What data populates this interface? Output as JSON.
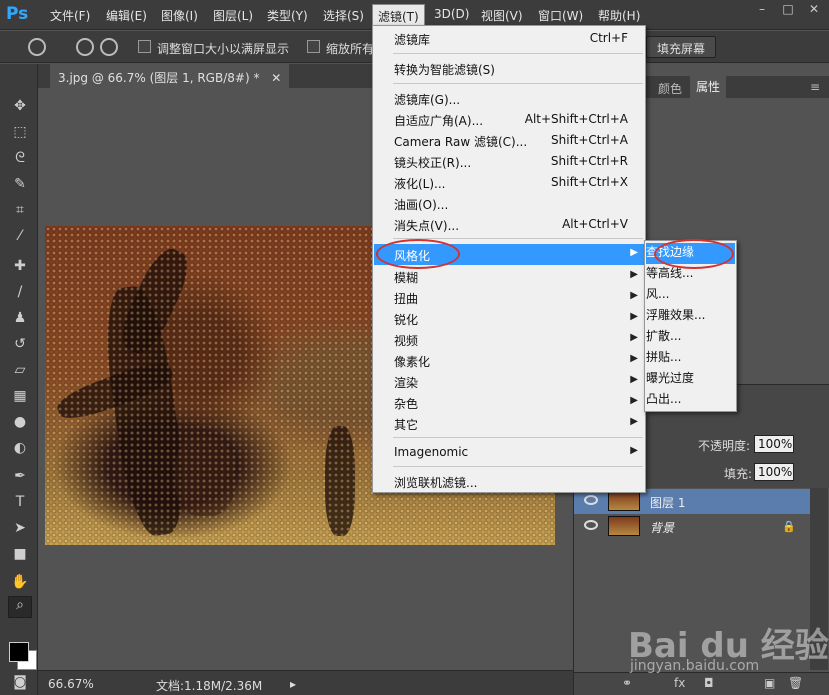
{
  "app": {
    "logo": "Ps"
  },
  "menubar": {
    "items": [
      "文件(F)",
      "编辑(E)",
      "图像(I)",
      "图层(L)",
      "类型(Y)",
      "选择(S)",
      "滤镜(T)",
      "3D(D)",
      "视图(V)",
      "窗口(W)",
      "帮助(H)"
    ],
    "active_index": 6
  },
  "options": {
    "resize_windows_label": "调整窗口大小以满屏显示",
    "zoom_all_label": "缩放所有",
    "fill_screen_label": "填充屏幕"
  },
  "document": {
    "tab_title": "3.jpg @ 66.7% (图层 1, RGB/8#) *"
  },
  "status": {
    "zoom": "66.67%",
    "doc_info": "文档:1.18M/2.36M"
  },
  "right_panel": {
    "tabs": [
      "颜色",
      "属性"
    ],
    "active_tab": "属性",
    "opacity_label": "不透明度:",
    "opacity_value": "100%",
    "fill_label": "填充:",
    "fill_value": "100%",
    "layers": [
      {
        "name": "图层 1",
        "selected": true,
        "locked": false
      },
      {
        "name": "背景",
        "selected": false,
        "locked": true
      }
    ]
  },
  "filter_menu": {
    "items": [
      {
        "label": "滤镜库",
        "shortcut": "Ctrl+F"
      },
      {
        "label": "转换为智能滤镜(S)",
        "shortcut": ""
      },
      {
        "label": "滤镜库(G)...",
        "shortcut": ""
      },
      {
        "label": "自适应广角(A)...",
        "shortcut": "Alt+Shift+Ctrl+A"
      },
      {
        "label": "Camera Raw 滤镜(C)...",
        "shortcut": "Shift+Ctrl+A"
      },
      {
        "label": "镜头校正(R)...",
        "shortcut": "Shift+Ctrl+R"
      },
      {
        "label": "液化(L)...",
        "shortcut": "Shift+Ctrl+X"
      },
      {
        "label": "油画(O)...",
        "shortcut": ""
      },
      {
        "label": "消失点(V)...",
        "shortcut": "Alt+Ctrl+V"
      },
      {
        "label": "风格化",
        "shortcut": "",
        "submenu": true,
        "highlighted": true
      },
      {
        "label": "模糊",
        "shortcut": "",
        "submenu": true
      },
      {
        "label": "扭曲",
        "shortcut": "",
        "submenu": true
      },
      {
        "label": "锐化",
        "shortcut": "",
        "submenu": true
      },
      {
        "label": "视频",
        "shortcut": "",
        "submenu": true
      },
      {
        "label": "像素化",
        "shortcut": "",
        "submenu": true
      },
      {
        "label": "渲染",
        "shortcut": "",
        "submenu": true
      },
      {
        "label": "杂色",
        "shortcut": "",
        "submenu": true
      },
      {
        "label": "其它",
        "shortcut": "",
        "submenu": true
      },
      {
        "label": "Imagenomic",
        "shortcut": "",
        "submenu": true
      },
      {
        "label": "浏览联机滤镜...",
        "shortcut": ""
      }
    ]
  },
  "stylize_submenu": {
    "items": [
      "查找边缘",
      "等高线...",
      "风...",
      "浮雕效果...",
      "扩散...",
      "拼贴...",
      "曝光过度",
      "凸出..."
    ],
    "highlighted_index": 0
  },
  "watermark": {
    "logo": "Bai du 经验",
    "url": "jingyan.baidu.com"
  }
}
